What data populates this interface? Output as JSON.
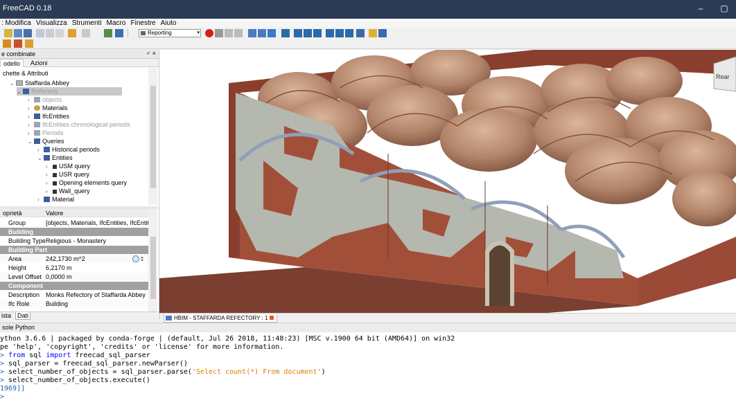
{
  "window": {
    "title": "FreeCAD 0.18",
    "min_glyph": "–",
    "max_glyph": "▢"
  },
  "menu": [
    ": Modifica",
    "Visualizza",
    "Strumenti",
    "Macro",
    "Finestre",
    "Aiuto"
  ],
  "toolbar": {
    "workbench": "Reporting"
  },
  "combo_view": {
    "title": "e combinate",
    "controls": "♂ ×",
    "tabs": [
      "odello",
      "Azioni"
    ]
  },
  "tree": {
    "header": "chette & Attributi",
    "items": [
      {
        "label": "Staffarda Abbey"
      },
      {
        "label": "Refectory"
      },
      {
        "label": "objects"
      },
      {
        "label": "Materials"
      },
      {
        "label": "IfcEntities"
      },
      {
        "label": "IfcEntities chronological periods"
      },
      {
        "label": "Periods"
      },
      {
        "label": "Queries"
      },
      {
        "label": "Historical periods"
      },
      {
        "label": "Entities"
      },
      {
        "label": "USM query"
      },
      {
        "label": "USR query"
      },
      {
        "label": "Opening elements query"
      },
      {
        "label": "Wall_query"
      },
      {
        "label": "Material"
      }
    ]
  },
  "properties": {
    "col_property": "oprietà",
    "col_value": "Valore",
    "group_row": {
      "key": "Group",
      "value": "[objects, Materials, IfcEntities, IfcEntities..."
    },
    "sections": [
      {
        "title": "Building",
        "rows": [
          {
            "key": "Building Type",
            "value": "Religious - Monastery"
          }
        ]
      },
      {
        "title": "Building Part",
        "rows": [
          {
            "key": "Area",
            "value": "242,1730 m^2"
          },
          {
            "key": "Height",
            "value": "6,2170 m"
          },
          {
            "key": "Level Offset",
            "value": "0,0000 m"
          }
        ]
      },
      {
        "title": "Component",
        "rows": [
          {
            "key": "Description",
            "value": "Monks Refectory of Staffarda Abbey"
          },
          {
            "key": "Ifc Role",
            "value": "Building"
          }
        ]
      }
    ]
  },
  "bottom_tabs": [
    "ista",
    "Dati"
  ],
  "viewport": {
    "navcube_label": "Rear",
    "colors": {
      "wall": "#a24f3a",
      "wall_dark": "#8a3f2e",
      "plaster": "#b4b8ae",
      "vault": "#b3856a",
      "ground": "#7a3f30"
    }
  },
  "document_tab": "HBIM - STAFFARDA REFECTORY : 1",
  "console": {
    "title": "sole Python",
    "lines": [
      {
        "text": "ython 3.6.6 | packaged by conda-forge | (default, Jul 26 2018, 11:48:23) [MSC v.1900 64 bit (AMD64)] on win32"
      },
      {
        "text": "pe 'help', 'copyright', 'credits' or 'license' for more information."
      },
      {
        "prompt": "> ",
        "kw1": "from",
        "mid": " sql ",
        "kw2": "import",
        "rest": " freecad_sql_parser"
      },
      {
        "prompt": "> ",
        "text": "sql_parser = freecad_sql_parser.newParser()"
      },
      {
        "prompt": "> ",
        "text": "select_number_of_objects = sql_parser.parse(",
        "str": "'Select count(*) From document'",
        "tail": ")"
      },
      {
        "prompt": "> ",
        "text": "select_number_of_objects.execute()"
      },
      {
        "text": "1969]]"
      },
      {
        "text": ">"
      }
    ]
  }
}
